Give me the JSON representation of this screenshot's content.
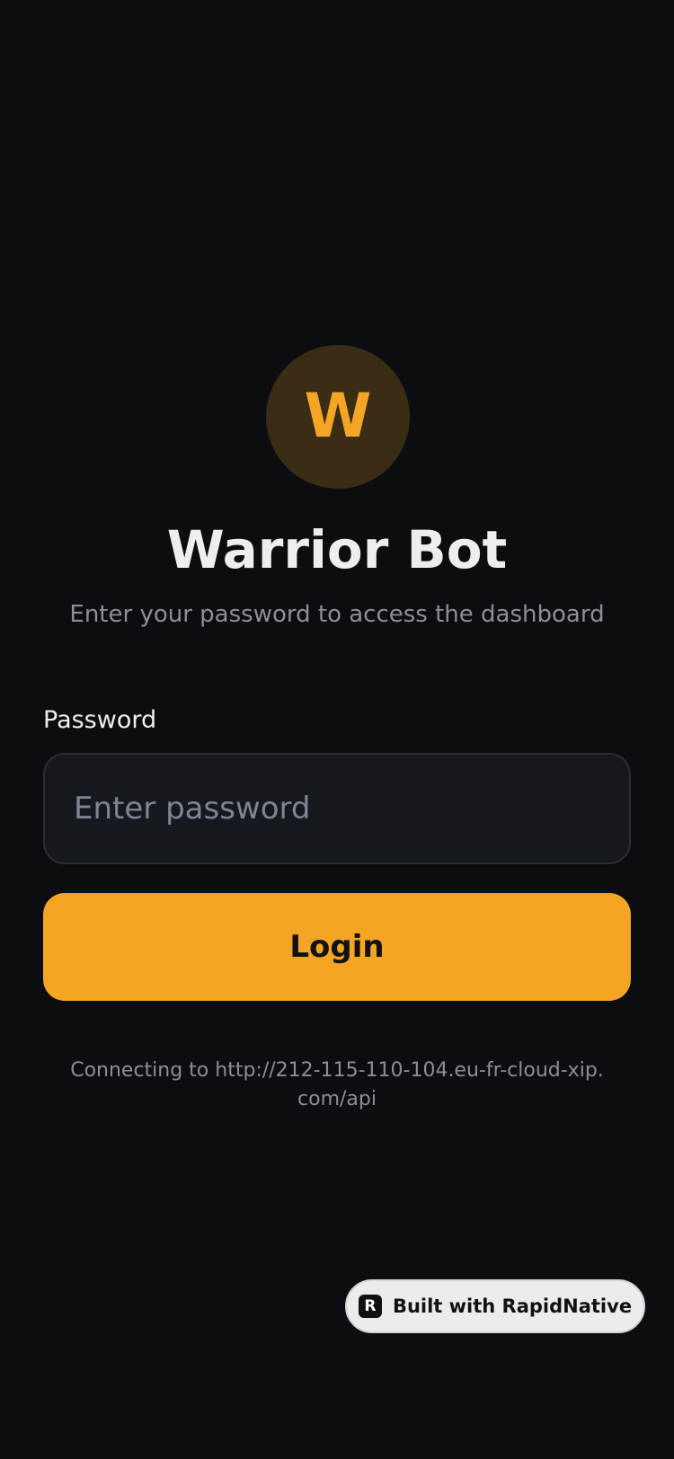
{
  "app": {
    "avatar_letter": "W",
    "title": "Warrior Bot",
    "subtitle": "Enter your password to access the dashboard"
  },
  "form": {
    "password_label": "Password",
    "password_value": "",
    "password_placeholder": "Enter password",
    "login_label": "Login"
  },
  "status": {
    "connecting_text": "Connecting to http://212-115-110-104.eu-fr-cloud-xip.com/api"
  },
  "badge": {
    "logo_glyph": "R",
    "label": "Built with RapidNative"
  },
  "colors": {
    "background": "#0c0d10",
    "accent": "#f4a524",
    "avatar_bg": "#3a2c15",
    "input_bg": "#15181d",
    "muted_text": "#8b8f98"
  },
  "icons": {
    "badge_logo": "rapidnative-logo-icon"
  }
}
